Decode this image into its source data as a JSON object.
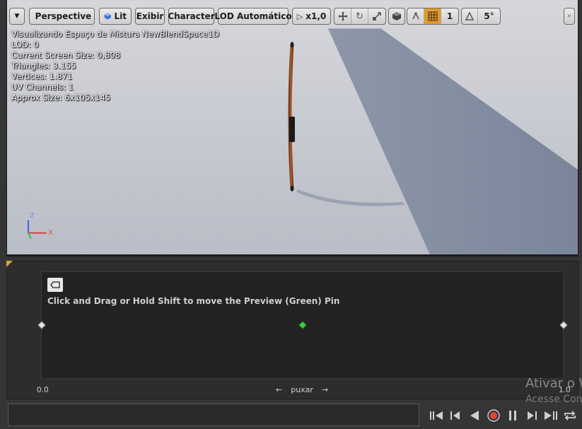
{
  "viewport": {
    "menu_icon": "chevron-down-icon",
    "toolbar": {
      "perspective_label": "Perspective",
      "lit_label": "Lit",
      "show_label": "Exibir",
      "character_label": "Character",
      "lod_label": "LOD Automático",
      "speed_label": "x1,0",
      "grid_snap_value": "1",
      "angle_snap_value": "5°"
    },
    "stats": {
      "title": "Visualizando Espaço de Mistura NewBlendSpace1D",
      "lod": "LOD: 0",
      "screen_size": "Current Screen Size: 0,808",
      "triangles": "Triangles: 3.155",
      "vertices": "Vertices: 1.871",
      "uv_channels": "UV Channels: 1",
      "approx_size": "Approx Size: 6x105x145"
    },
    "axis_gizmo": {
      "z": "Z",
      "x": "X"
    }
  },
  "blend_space": {
    "instruction": "Click and Drag or Hold Shift to move the Preview (Green) Pin",
    "axis_min": "0.0",
    "axis_max": "1.0",
    "axis_name": "puxar",
    "arrow_left": "←",
    "arrow_right": "→",
    "preview_pin_value": 0.5,
    "sample_points": [
      0.0,
      1.0
    ],
    "colors": {
      "preview_pin": "#3ed43e",
      "sample_pin": "#e6e6e6"
    }
  },
  "watermark": {
    "line1": "Ativar o W",
    "line2": "Acesse Conf"
  },
  "transport": {
    "buttons": [
      "skip-to-start-icon",
      "step-back-icon",
      "play-reverse-icon",
      "record-icon",
      "pause-icon",
      "step-forward-icon",
      "skip-to-end-icon",
      "loop-icon"
    ],
    "record_color": "#e0453a"
  }
}
